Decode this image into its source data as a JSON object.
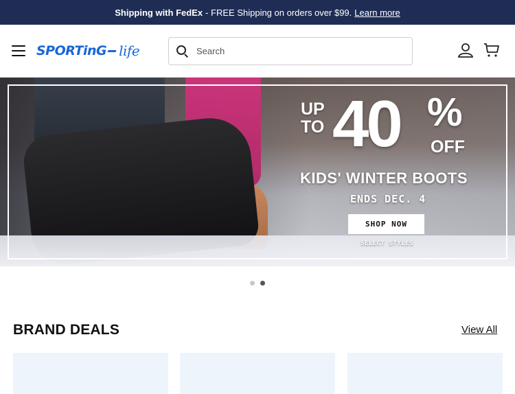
{
  "promo": {
    "bold": "Shipping with FedEx",
    "text": " - FREE Shipping on orders over $99.",
    "link": "Learn more"
  },
  "header": {
    "logo_main": "SPORTinG",
    "logo_script": "life",
    "search_placeholder": "Search"
  },
  "hero": {
    "up_to": "UP",
    "to": "TO",
    "amount": "40",
    "percent": "%",
    "off": "OFF",
    "headline": "KIDS' WINTER BOOTS",
    "ends": "ENDS DEC. 4",
    "cta": "SHOP NOW",
    "subnote": "SELECT STYLES"
  },
  "carousel": {
    "slides": 2,
    "active": 2
  },
  "brand_deals": {
    "title": "BRAND DEALS",
    "view_all": "View All"
  },
  "colors": {
    "promo_bg": "#1f2d55",
    "logo_blue": "#1a66d6",
    "card_bg": "#eef4fb"
  },
  "icons": [
    "menu-icon",
    "search-icon",
    "account-icon",
    "cart-icon"
  ]
}
